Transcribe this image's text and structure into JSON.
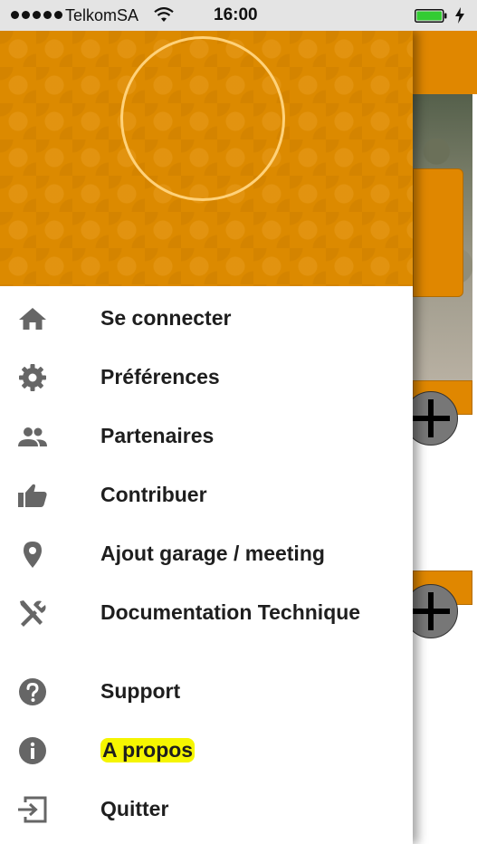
{
  "status_bar": {
    "carrier": "TelkomSA",
    "time": "16:00"
  },
  "menu": {
    "items": [
      {
        "label": "Se connecter",
        "icon": "home-icon"
      },
      {
        "label": "Préférences",
        "icon": "gear-icon"
      },
      {
        "label": "Partenaires",
        "icon": "people-icon"
      },
      {
        "label": "Contribuer",
        "icon": "thumbs-up-icon"
      },
      {
        "label": "Ajout garage / meeting",
        "icon": "location-pin-icon"
      },
      {
        "label": "Documentation Technique",
        "icon": "tools-icon"
      },
      {
        "label": "Support",
        "icon": "help-icon"
      },
      {
        "label": "A propos",
        "icon": "info-icon"
      },
      {
        "label": "Quitter",
        "icon": "exit-icon"
      }
    ]
  },
  "colors": {
    "accent": "#dc8a00",
    "highlight": "#f5f500",
    "icon": "#666666"
  }
}
